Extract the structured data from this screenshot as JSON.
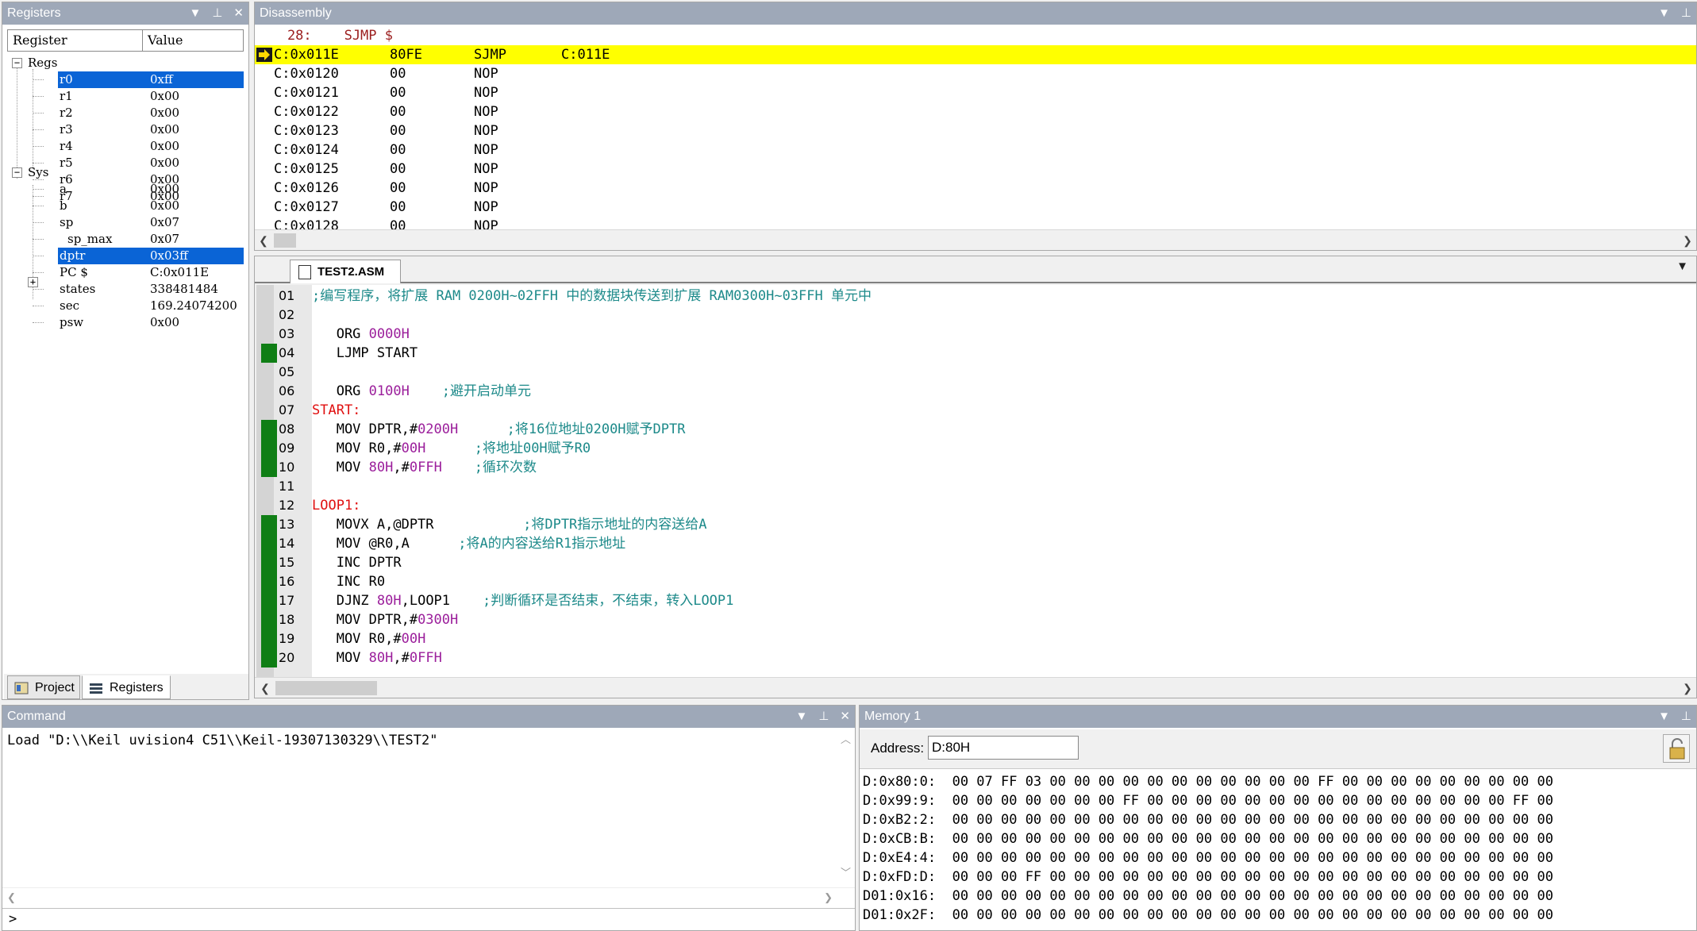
{
  "registers": {
    "title": "Registers",
    "col_register": "Register",
    "col_value": "Value",
    "groups": [
      {
        "label": "Regs"
      },
      {
        "label": "Sys"
      }
    ],
    "rows": [
      {
        "name": "r0",
        "value": "0xff",
        "selected": true
      },
      {
        "name": "r1",
        "value": "0x00"
      },
      {
        "name": "r2",
        "value": "0x00"
      },
      {
        "name": "r3",
        "value": "0x00"
      },
      {
        "name": "r4",
        "value": "0x00"
      },
      {
        "name": "r5",
        "value": "0x00"
      },
      {
        "name": "r6",
        "value": "0x00"
      },
      {
        "name": "r7",
        "value": "0x00"
      },
      {
        "name": "a",
        "value": "0x00"
      },
      {
        "name": "b",
        "value": "0x00"
      },
      {
        "name": "sp",
        "value": "0x07"
      },
      {
        "name": "sp_max",
        "value": "0x07"
      },
      {
        "name": "dptr",
        "value": "0x03ff",
        "selected": true
      },
      {
        "name": "PC  $",
        "value": "C:0x011E"
      },
      {
        "name": "states",
        "value": "338481484"
      },
      {
        "name": "sec",
        "value": "169.24074200"
      },
      {
        "name": "psw",
        "value": "0x00"
      }
    ],
    "tab_project": "Project",
    "tab_registers": "Registers"
  },
  "disassembly": {
    "title": "Disassembly",
    "source_line": "    28:    SJMP $",
    "rows": [
      {
        "addr": "C:0x011E",
        "bytes": "80FE",
        "mnemonic": "SJMP",
        "operand": "C:011E",
        "current": true
      },
      {
        "addr": "C:0x0120",
        "bytes": "00",
        "mnemonic": "NOP",
        "operand": ""
      },
      {
        "addr": "C:0x0121",
        "bytes": "00",
        "mnemonic": "NOP",
        "operand": ""
      },
      {
        "addr": "C:0x0122",
        "bytes": "00",
        "mnemonic": "NOP",
        "operand": ""
      },
      {
        "addr": "C:0x0123",
        "bytes": "00",
        "mnemonic": "NOP",
        "operand": ""
      },
      {
        "addr": "C:0x0124",
        "bytes": "00",
        "mnemonic": "NOP",
        "operand": ""
      },
      {
        "addr": "C:0x0125",
        "bytes": "00",
        "mnemonic": "NOP",
        "operand": ""
      },
      {
        "addr": "C:0x0126",
        "bytes": "00",
        "mnemonic": "NOP",
        "operand": ""
      },
      {
        "addr": "C:0x0127",
        "bytes": "00",
        "mnemonic": "NOP",
        "operand": ""
      },
      {
        "addr": "C:0x0128",
        "bytes": "00",
        "mnemonic": "NOP",
        "operand": ""
      }
    ]
  },
  "editor": {
    "tab_label": "TEST2.ASM",
    "lines": [
      {
        "no": "01",
        "mark": false,
        "parts": [
          {
            "t": ";编写程序，将扩展 RAM 0200H~02FFH 中的数据块传送到扩展 RAM0300H~03FFH 单元中",
            "c": "cmt"
          }
        ]
      },
      {
        "no": "02",
        "mark": false,
        "parts": []
      },
      {
        "no": "03",
        "mark": false,
        "parts": [
          {
            "t": "   ORG ",
            "c": "kw"
          },
          {
            "t": "0000H",
            "c": "num"
          }
        ]
      },
      {
        "no": "04",
        "mark": true,
        "parts": [
          {
            "t": "   LJMP START",
            "c": "kw"
          }
        ]
      },
      {
        "no": "05",
        "mark": false,
        "parts": []
      },
      {
        "no": "06",
        "mark": false,
        "parts": [
          {
            "t": "   ORG ",
            "c": "kw"
          },
          {
            "t": "0100H",
            "c": "num"
          },
          {
            "t": "    ;避开启动单元",
            "c": "cmt"
          }
        ]
      },
      {
        "no": "07",
        "mark": false,
        "parts": [
          {
            "t": "START:",
            "c": "lbl"
          }
        ]
      },
      {
        "no": "08",
        "mark": true,
        "parts": [
          {
            "t": "   MOV DPTR,#",
            "c": "kw"
          },
          {
            "t": "0200H",
            "c": "num"
          },
          {
            "t": "      ;将16位地址0200H赋予DPTR",
            "c": "cmt"
          }
        ]
      },
      {
        "no": "09",
        "mark": true,
        "parts": [
          {
            "t": "   MOV R0,#",
            "c": "kw"
          },
          {
            "t": "00H",
            "c": "num"
          },
          {
            "t": "      ;将地址00H赋予R0",
            "c": "cmt"
          }
        ]
      },
      {
        "no": "10",
        "mark": true,
        "parts": [
          {
            "t": "   MOV ",
            "c": "kw"
          },
          {
            "t": "80H",
            "c": "num"
          },
          {
            "t": ",#",
            "c": "kw"
          },
          {
            "t": "0FFH",
            "c": "num"
          },
          {
            "t": "    ;循环次数",
            "c": "cmt"
          }
        ]
      },
      {
        "no": "11",
        "mark": false,
        "parts": []
      },
      {
        "no": "12",
        "mark": false,
        "parts": [
          {
            "t": "LOOP1:",
            "c": "lbl"
          }
        ]
      },
      {
        "no": "13",
        "mark": true,
        "parts": [
          {
            "t": "   MOVX A,@DPTR",
            "c": "kw"
          },
          {
            "t": "           ;将DPTR指示地址的内容送给A",
            "c": "cmt"
          }
        ]
      },
      {
        "no": "14",
        "mark": true,
        "parts": [
          {
            "t": "   MOV @R0,A",
            "c": "kw"
          },
          {
            "t": "      ;将A的内容送给R1指示地址",
            "c": "cmt"
          }
        ]
      },
      {
        "no": "15",
        "mark": true,
        "parts": [
          {
            "t": "   INC DPTR",
            "c": "kw"
          }
        ]
      },
      {
        "no": "16",
        "mark": true,
        "parts": [
          {
            "t": "   INC R0",
            "c": "kw"
          }
        ]
      },
      {
        "no": "17",
        "mark": true,
        "parts": [
          {
            "t": "   DJNZ ",
            "c": "kw"
          },
          {
            "t": "80H",
            "c": "num"
          },
          {
            "t": ",LOOP1",
            "c": "kw"
          },
          {
            "t": "    ;判断循环是否结束，不结束，转入LOOP1",
            "c": "cmt"
          }
        ]
      },
      {
        "no": "18",
        "mark": true,
        "parts": [
          {
            "t": "   MOV DPTR,#",
            "c": "kw"
          },
          {
            "t": "0300H",
            "c": "num"
          }
        ]
      },
      {
        "no": "19",
        "mark": true,
        "parts": [
          {
            "t": "   MOV R0,#",
            "c": "kw"
          },
          {
            "t": "00H",
            "c": "num"
          }
        ]
      },
      {
        "no": "20",
        "mark": true,
        "parts": [
          {
            "t": "   MOV ",
            "c": "kw"
          },
          {
            "t": "80H",
            "c": "num"
          },
          {
            "t": ",#",
            "c": "kw"
          },
          {
            "t": "0FFH",
            "c": "num"
          }
        ]
      }
    ]
  },
  "command": {
    "title": "Command",
    "output": "Load \"D:\\\\Keil uvision4 C51\\\\Keil-19307130329\\\\TEST2\"",
    "prompt": ">"
  },
  "memory": {
    "title": "Memory 1",
    "address_label": "Address:",
    "address_value": "D:80H",
    "rows": [
      "D:0x80:0:  00 07 FF 03 00 00 00 00 00 00 00 00 00 00 00 FF 00 00 00 00 00 00 00 00 00",
      "D:0x99:9:  00 00 00 00 00 00 00 FF 00 00 00 00 00 00 00 00 00 00 00 00 00 00 00 FF 00",
      "D:0xB2:2:  00 00 00 00 00 00 00 00 00 00 00 00 00 00 00 00 00 00 00 00 00 00 00 00 00",
      "D:0xCB:B:  00 00 00 00 00 00 00 00 00 00 00 00 00 00 00 00 00 00 00 00 00 00 00 00 00",
      "D:0xE4:4:  00 00 00 00 00 00 00 00 00 00 00 00 00 00 00 00 00 00 00 00 00 00 00 00 00",
      "D:0xFD:D:  00 00 00 FF 00 00 00 00 00 00 00 00 00 00 00 00 00 00 00 00 00 00 00 00 00",
      "D01:0x16:  00 00 00 00 00 00 00 00 00 00 00 00 00 00 00 00 00 00 00 00 00 00 00 00 00",
      "D01:0x2F:  00 00 00 00 00 00 00 00 00 00 00 00 00 00 00 00 00 00 00 00 00 00 00 00 00"
    ]
  },
  "colors": {
    "title_bar": "#9ea8b8",
    "selection": "#0a64d6",
    "current_line": "#ffff00",
    "exec_mark": "#0f7e15",
    "number": "#9b1e9b",
    "label": "#e01010",
    "comment": "#1d8a8a"
  }
}
